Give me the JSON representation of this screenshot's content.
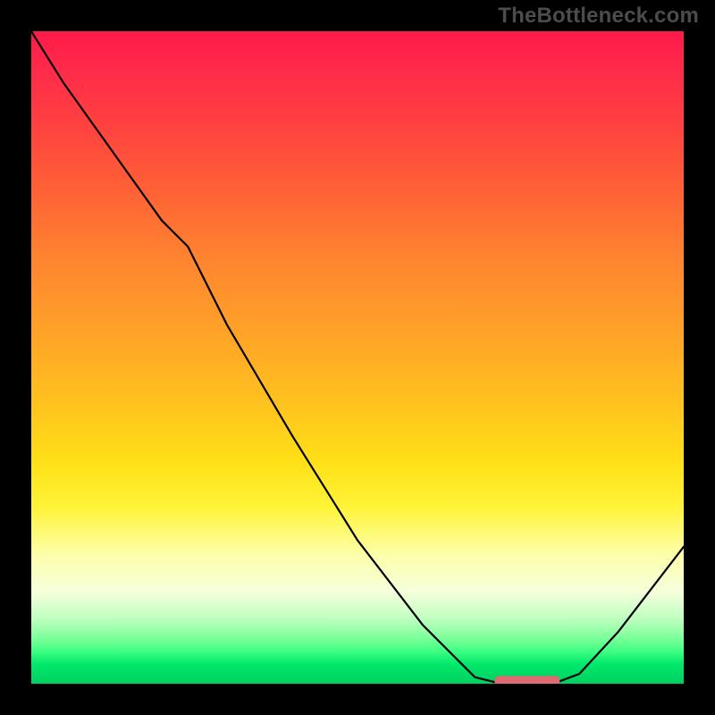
{
  "watermark": "TheBottleneck.com",
  "colors": {
    "gradient_top": "#ff1a4a",
    "gradient_yellow": "#ffe018",
    "gradient_bottom": "#00d060",
    "curve": "#000000",
    "marker": "#e06a6f",
    "frame": "#000000"
  },
  "chart_data": {
    "type": "line",
    "title": "",
    "xlabel": "",
    "ylabel": "",
    "xlim": [
      0,
      100
    ],
    "ylim": [
      0,
      100
    ],
    "x": [
      0,
      5,
      10,
      15,
      20,
      24,
      30,
      40,
      50,
      60,
      68,
      72,
      76,
      80,
      84,
      90,
      100
    ],
    "values": [
      100,
      92,
      85,
      78,
      71,
      67,
      55,
      38,
      22,
      9,
      1,
      0,
      0,
      0,
      1.5,
      8,
      21
    ],
    "marker": {
      "x_start": 71,
      "x_end": 81,
      "y": 0.5
    },
    "notes": "y-values are read as fraction of plot height above bottom; the flat minimum sits on the green band near y≈0 around x≈72–80; gradient encodes red (top) to green (bottom)."
  }
}
